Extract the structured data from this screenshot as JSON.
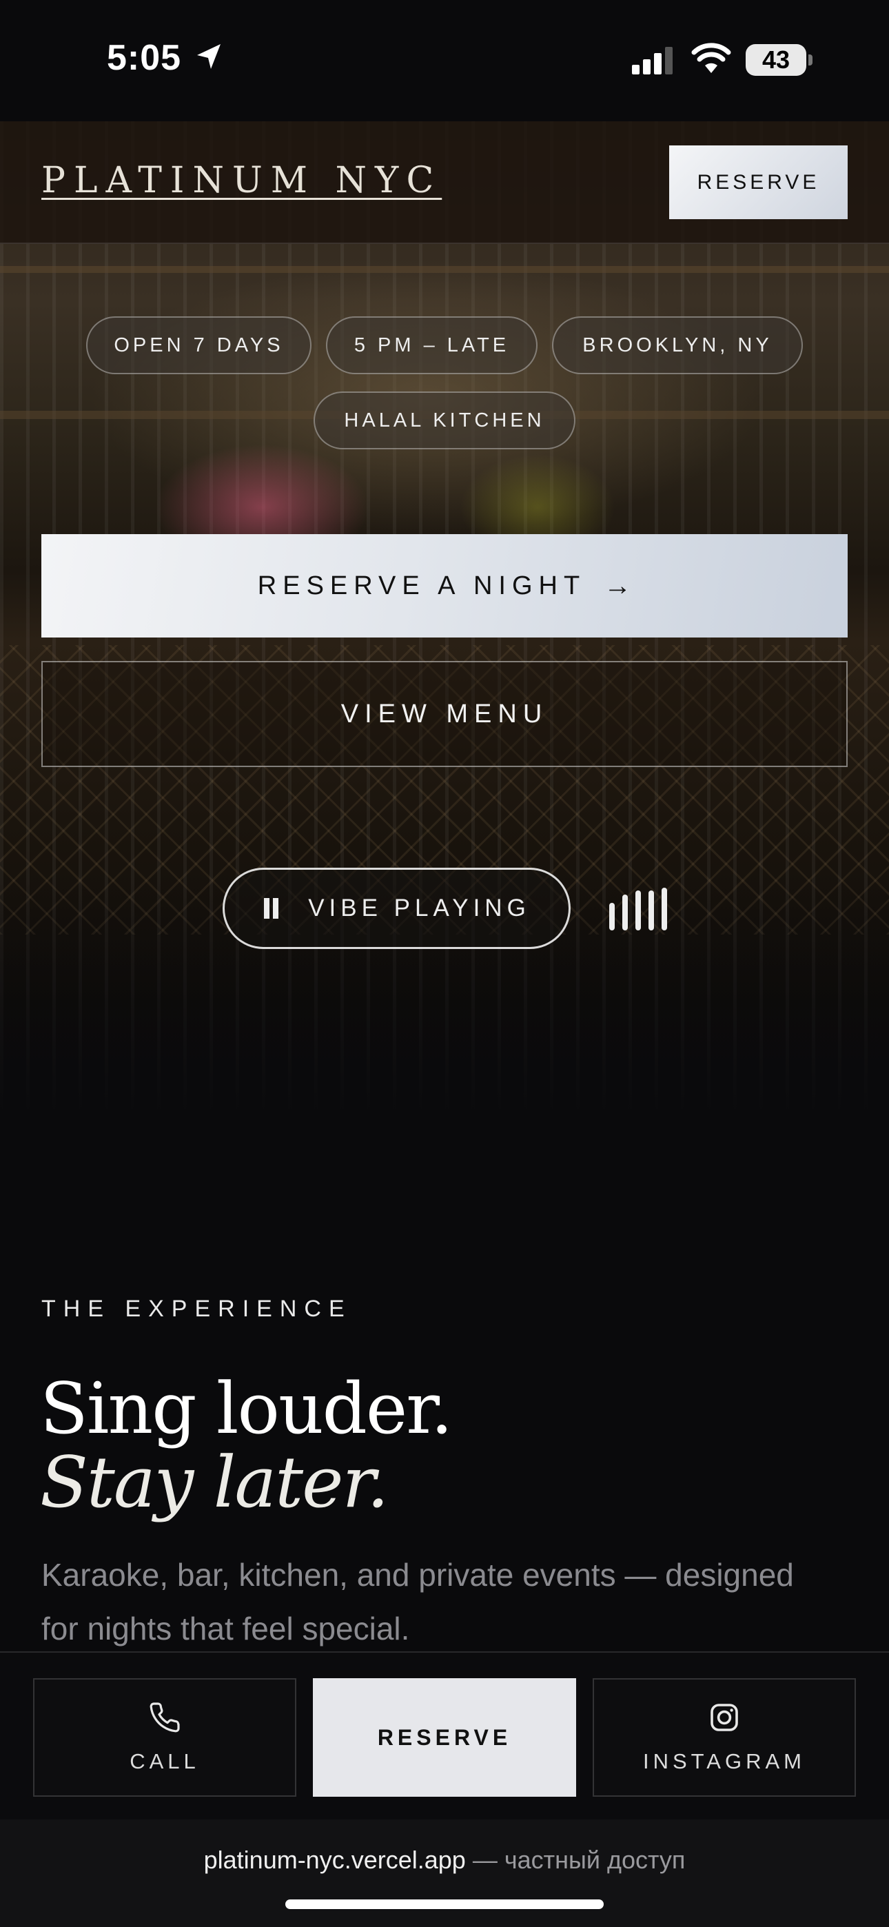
{
  "status_bar": {
    "time": "5:05",
    "battery": "43"
  },
  "header": {
    "brand": "PLATINUM NYC",
    "reserve_label": "RESERVE"
  },
  "hero": {
    "pills": [
      "OPEN 7 DAYS",
      "5 PM – LATE",
      "BROOKLYN, NY",
      "HALAL KITCHEN"
    ],
    "reserve_night_label": "RESERVE A NIGHT",
    "reserve_night_arrow": "→",
    "view_menu_label": "VIEW MENU",
    "vibe_label": "VIBE PLAYING"
  },
  "experience": {
    "label": "THE EXPERIENCE",
    "headline_line1": "Sing louder.",
    "headline_line2": "Stay later.",
    "description": "Karaoke, bar, kitchen, and private events — designed for nights that feel special."
  },
  "bottom_bar": {
    "call_label": "CALL",
    "reserve_label": "RESERVE",
    "instagram_label": "INSTAGRAM"
  },
  "browser": {
    "url": "platinum-nyc.vercel.app",
    "suffix": " — частный доступ"
  },
  "colors": {
    "background": "#0a0a0c",
    "button_light": "#e6e7eb",
    "text_muted": "#8b8b90"
  },
  "icons": {
    "location": "location-arrow-icon",
    "signal": "cellular-signal-icon",
    "wifi": "wifi-icon",
    "pause": "pause-icon",
    "equalizer": "equalizer-icon",
    "phone": "phone-icon",
    "instagram": "instagram-icon"
  }
}
